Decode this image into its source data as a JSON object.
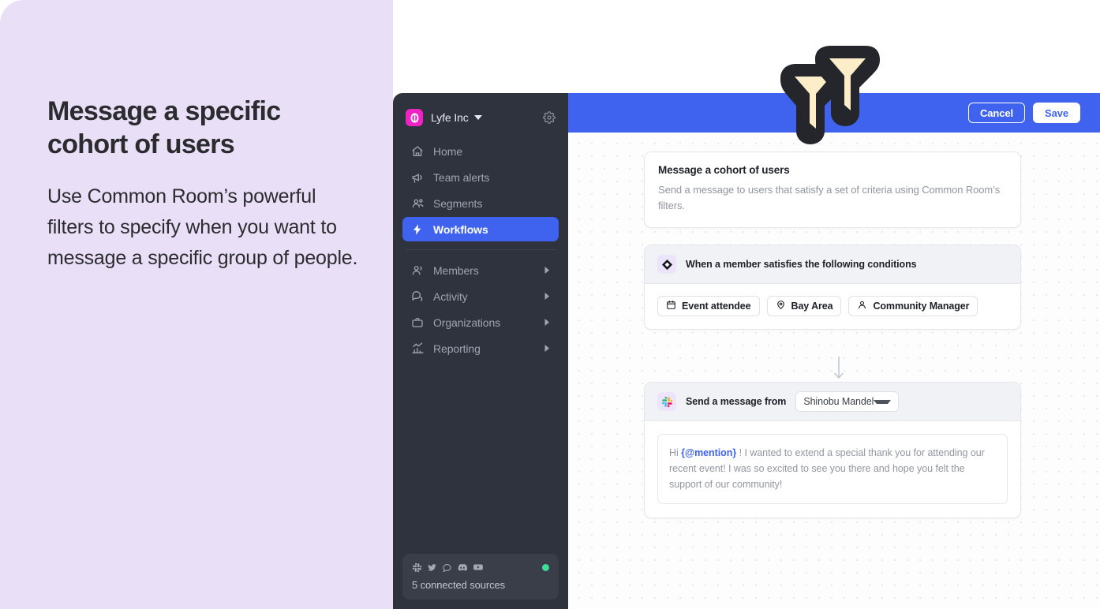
{
  "promo": {
    "title": "Message a specific cohort of users",
    "body": "Use Common Room’s powerful filters to specify when you want to message a specific group of people."
  },
  "colors": {
    "promo_bg": "#e9dff7",
    "accent_blue": "#3f63ee",
    "sidebar_bg": "#2f333d",
    "brand_pink": "#ef22c3",
    "status_green": "#3ddc97",
    "logo_dark": "#24262b",
    "logo_cream": "#fdedc8"
  },
  "brand": {
    "logo_name": "common-room-funnel-logo"
  },
  "sidebar": {
    "workspace": {
      "name": "Lyfe Inc",
      "logo_icon": "lyfe-inc-logo",
      "caret_icon": "chevron-down-icon",
      "settings_icon": "gear-icon"
    },
    "primary_items": [
      {
        "label": "Home",
        "icon": "home-icon",
        "active": false,
        "has_arrow": false
      },
      {
        "label": "Team alerts",
        "icon": "megaphone-icon",
        "active": false,
        "has_arrow": false
      },
      {
        "label": "Segments",
        "icon": "people-group-icon",
        "active": false,
        "has_arrow": false
      },
      {
        "label": "Workflows",
        "icon": "lightning-bolt-icon",
        "active": true,
        "has_arrow": false
      }
    ],
    "secondary_items": [
      {
        "label": "Members",
        "icon": "users-icon",
        "has_arrow": true
      },
      {
        "label": "Activity",
        "icon": "chat-bubbles-icon",
        "has_arrow": true
      },
      {
        "label": "Organizations",
        "icon": "briefcase-icon",
        "has_arrow": true
      },
      {
        "label": "Reporting",
        "icon": "bar-chart-icon",
        "has_arrow": true
      }
    ],
    "sources": {
      "label": "5 connected sources",
      "icons": [
        "slack-icon",
        "twitter-icon",
        "chat-icon",
        "discord-icon",
        "youtube-icon"
      ],
      "status_dot": "online-status-dot"
    }
  },
  "topbar": {
    "cancel_label": "Cancel",
    "save_label": "Save"
  },
  "workflow": {
    "header": {
      "title": "Message a cohort of users",
      "description": "Send a message to users that satisfy a set of criteria using Common Room’s filters."
    },
    "trigger": {
      "icon": "diamond-trigger-icon",
      "title": "When a member satisfies the following conditions",
      "chips": [
        {
          "label": "Event attendee",
          "icon": "calendar-icon"
        },
        {
          "label": "Bay Area",
          "icon": "location-pin-icon"
        },
        {
          "label": "Community Manager",
          "icon": "person-icon"
        }
      ]
    },
    "connector_icon": "arrow-down-icon",
    "action": {
      "icon": "slack-icon",
      "title": "Send a message from",
      "sender": "Shinobu Mandel",
      "sender_caret_icon": "chevron-down-icon",
      "message": {
        "prefix": "Hi ",
        "mention": "{@mention}",
        "rest": " ! I wanted to extend a special thank you for attending our recent event! I was so excited to see you there and hope you felt the support of our community!"
      }
    }
  }
}
